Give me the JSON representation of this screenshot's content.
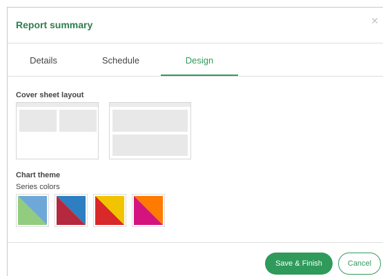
{
  "dialog": {
    "title": "Report summary",
    "close_icon": "close-icon"
  },
  "tabs": [
    {
      "label": "Details",
      "active": false
    },
    {
      "label": "Schedule",
      "active": false
    },
    {
      "label": "Design",
      "active": true
    }
  ],
  "design": {
    "cover_sheet_label": "Cover sheet layout",
    "layouts": [
      {
        "name": "two-column-layout"
      },
      {
        "name": "two-row-layout"
      }
    ],
    "chart_theme_label": "Chart theme",
    "series_colors_label": "Series colors",
    "palettes": [
      {
        "name": "blue-green",
        "colors": [
          "#6ea8d8",
          "#92cc7e"
        ]
      },
      {
        "name": "blue-red",
        "colors": [
          "#2d7fc1",
          "#b5293e"
        ]
      },
      {
        "name": "yellow-red",
        "colors": [
          "#f2c400",
          "#d8282a"
        ]
      },
      {
        "name": "orange-magenta",
        "colors": [
          "#ff7a00",
          "#d4137f"
        ]
      }
    ]
  },
  "footer": {
    "save_label": "Save & Finish",
    "cancel_label": "Cancel"
  },
  "colors": {
    "accent": "#2f9a5a",
    "title": "#2e7d4f"
  }
}
